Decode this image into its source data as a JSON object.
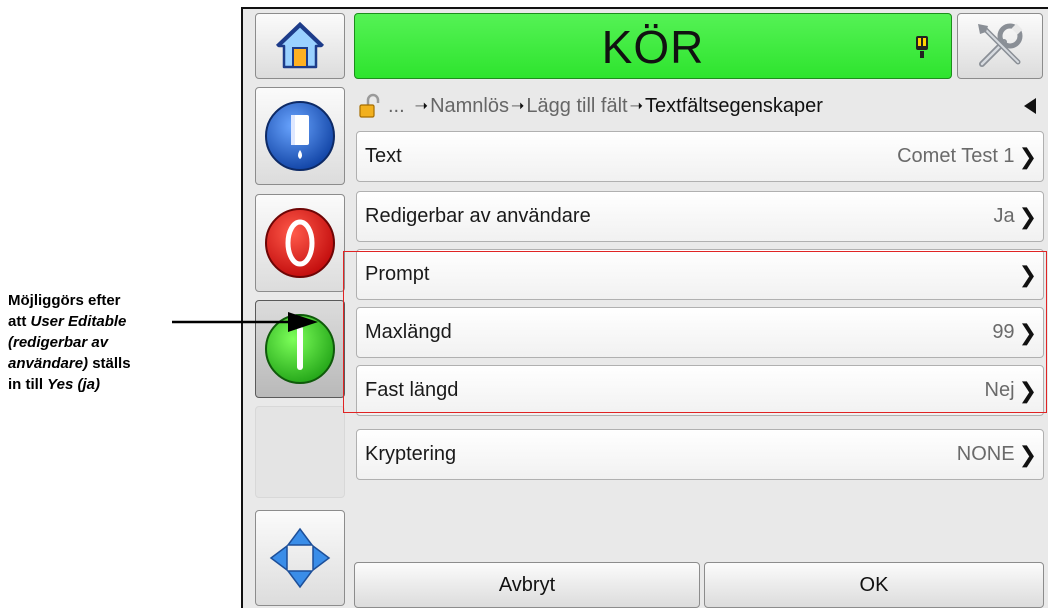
{
  "annotation": {
    "line1": "Möjliggörs efter",
    "line2_prefix": "att ",
    "line2_italic": "User Editable",
    "line3_italic": "(redigerbar av",
    "line4_italic": "användare)",
    "line4_suffix": " ställs",
    "line5_prefix": "in till ",
    "line5_italic": "Yes (ja)"
  },
  "header": {
    "status": "KÖR",
    "status_color": "#3ce83c"
  },
  "breadcrumb": {
    "ellipsis": "...",
    "items": [
      "Namnlös",
      "Lägg till fält"
    ],
    "current": "Textfältsegenskaper"
  },
  "rows": [
    {
      "label": "Text",
      "value": "Comet Test 1"
    },
    {
      "label": "Redigerbar av användare",
      "value": "Ja"
    },
    {
      "label": "Prompt",
      "value": ""
    },
    {
      "label": "Maxlängd",
      "value": "99"
    },
    {
      "label": "Fast längd",
      "value": "Nej"
    },
    {
      "label": "Kryptering",
      "value": "NONE"
    }
  ],
  "buttons": {
    "cancel": "Avbryt",
    "ok": "OK"
  },
  "icons": {
    "home": "home-icon",
    "tools": "tools-icon",
    "ink": "ink-bottle-icon",
    "stop": "stop-icon",
    "start": "start-icon",
    "nav": "navigation-arrows-icon",
    "lock": "unlocked-padlock-icon",
    "back": "back-arrow-icon",
    "alert": "alert-icon"
  },
  "colors": {
    "accent_red": "#e02424",
    "status_green": "#3ce83c"
  }
}
